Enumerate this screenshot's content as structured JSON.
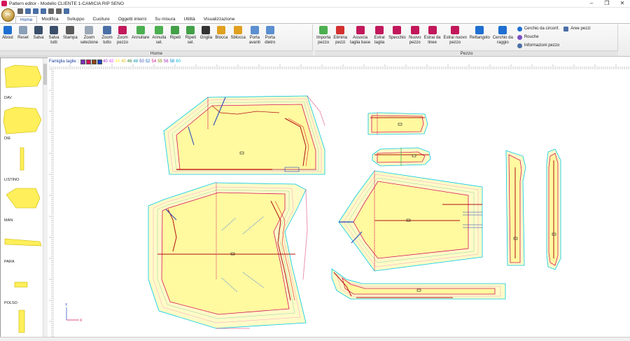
{
  "window": {
    "title": "Pattern editor - Modello CLIENTE 1-CAMICIA RIP SENO",
    "minimize": "–",
    "maximize": "❐",
    "close": "✕"
  },
  "tabs": [
    "Home",
    "Modifica",
    "Sviluppo",
    "Cuciture",
    "Oggetti interni",
    "Su misura",
    "Utilità",
    "Visualizzazione"
  ],
  "ribbon": {
    "home_group_title": "Home",
    "pezzo_group_title": "Pezzo",
    "home_buttons": [
      {
        "label": "About",
        "icon": "info-icon",
        "color": "#1f6fd1"
      },
      {
        "label": "Reset",
        "icon": "cursor-icon",
        "color": "#8aa0b8"
      },
      {
        "label": "Salva",
        "icon": "save-icon",
        "color": "#3b4f6b"
      },
      {
        "label": "Salva\ntutti",
        "icon": "save-all-icon",
        "color": "#3b4f6b"
      },
      {
        "label": "Stampa",
        "icon": "print-icon",
        "color": "#5a5a5a"
      },
      {
        "label": "Zoom\nselezione",
        "icon": "zoom-selection-icon",
        "color": "#9aa7b5"
      },
      {
        "label": "Zoom\ntutto",
        "icon": "zoom-all-icon",
        "color": "#4a6fa5"
      },
      {
        "label": "Zoom\npezzo",
        "icon": "zoom-piece-icon",
        "color": "#c2185b"
      },
      {
        "label": "Annullare",
        "icon": "undo-icon",
        "color": "#4caf50"
      },
      {
        "label": "Annulla\nsel.",
        "icon": "undo-selection-icon",
        "color": "#4caf50"
      },
      {
        "label": "Ripeti",
        "icon": "redo-icon",
        "color": "#43a047"
      },
      {
        "label": "Ripeti\nsel.",
        "icon": "redo-selection-icon",
        "color": "#43a047"
      },
      {
        "label": "Griglia",
        "icon": "grid-icon",
        "color": "#333333"
      },
      {
        "label": "Blocca",
        "icon": "lock-icon",
        "color": "#e0a020"
      },
      {
        "label": "Sblocca",
        "icon": "unlock-icon",
        "color": "#e0a020"
      },
      {
        "label": "Porta\navanti",
        "icon": "bring-forward-icon",
        "color": "#5b8fd0"
      },
      {
        "label": "Porta\ndietro",
        "icon": "send-backward-icon",
        "color": "#5b8fd0"
      }
    ],
    "pezzo_buttons": [
      {
        "label": "Importa\npezzo",
        "icon": "import-piece-icon",
        "color": "#4caf50"
      },
      {
        "label": "Elimina\npezzi",
        "icon": "delete-piece-icon",
        "color": "#d32f2f"
      },
      {
        "label": "Associa\ntaglia base",
        "icon": "associate-size-icon",
        "color": "#c2185b"
      },
      {
        "label": "Estrai\ntaglia",
        "icon": "extract-size-icon",
        "color": "#c2185b"
      },
      {
        "label": "Specchio",
        "icon": "mirror-icon",
        "color": "#c2185b"
      },
      {
        "label": "Nuovo\npezzo",
        "icon": "new-piece-icon",
        "color": "#c2185b"
      },
      {
        "label": "Estrai da\nlinee",
        "icon": "extract-lines-icon",
        "color": "#c2185b"
      },
      {
        "label": "Estrai nuovo\npezzo",
        "icon": "extract-new-piece-icon",
        "color": "#c2185b"
      },
      {
        "label": "Rettangolo",
        "icon": "rectangle-icon",
        "color": "#1f6fd1"
      },
      {
        "label": "Cerchio da\nraggio",
        "icon": "circle-radius-icon",
        "color": "#1f6fd1"
      }
    ],
    "small_buttons": [
      {
        "label": "Cerchio da circonf.",
        "icon": "circle-circumference-icon",
        "color": "#1f6fd1"
      },
      {
        "label": "Rouche",
        "icon": "ruche-icon",
        "color": "#7a4fc2"
      },
      {
        "label": "Informazioni pezzo",
        "icon": "piece-info-icon",
        "color": "#4a6fa5"
      }
    ],
    "aree_pezzi": "Aree pezzi"
  },
  "left_panel": {
    "pieces": [
      "DAV",
      "DIE",
      "LISTINO",
      "MAN",
      "PARA",
      "POLSO",
      ""
    ]
  },
  "famiglia_taglie": {
    "label": "Famiglia taglie :",
    "sizes": [
      "",
      "",
      "",
      "",
      "40",
      "42",
      "44",
      "45",
      "46",
      "48",
      "50",
      "52",
      "54",
      "55",
      "56",
      "58",
      "60"
    ],
    "colors": [
      "#7b2fbe",
      "#d4145a",
      "#8b4513",
      "#1f3fbf",
      "#9932cc",
      "#e040fb",
      "#ffeb3b",
      "#e0c020",
      "#2e7d32",
      "#0097a7",
      "#3f51b5",
      "#1565c0",
      "#c71585",
      "#808000",
      "#9c27b0",
      "#0288d1",
      "#00bcd4"
    ]
  },
  "axis_labels": {
    "x": "X",
    "y": "Y"
  }
}
